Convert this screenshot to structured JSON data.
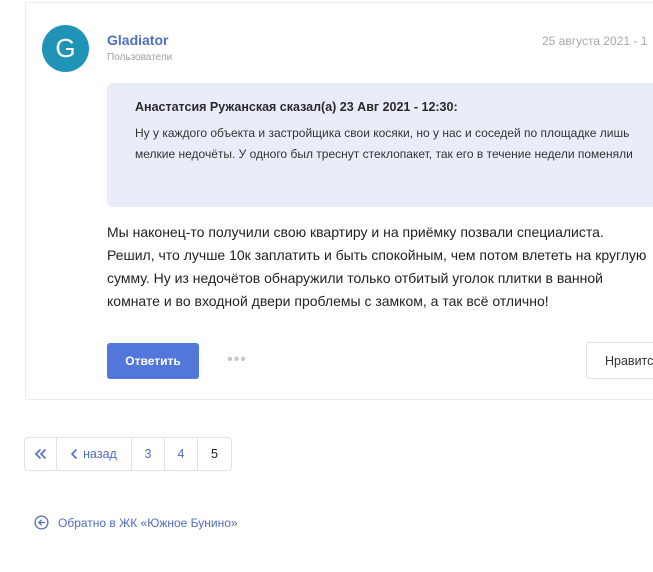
{
  "post": {
    "avatar_letter": "G",
    "author": "Gladiator",
    "group": "Пользователи",
    "date": "25 августа 2021 - 1",
    "quote": {
      "header": "Анастатсия Ружанская сказал(а) 23 Авг 2021 - 12:30:",
      "text": "Ну у каждого объекта и застройщика свои косяки, но у нас и соседей по площадке лишь мелкие недочёты. У одного был треснут стеклопакет, так его в течение недели поменяли"
    },
    "message": "Мы наконец-то получили свою квартиру и на приёмку позвали специалиста. Решил, что лучше 10к заплатить и быть спокойным, чем потом влететь на круглую сумму. Ну из недочётов обнаружили только отбитый уголок плитки в ванной комнате и во входной двери проблемы с замком, а так всё отлично!",
    "actions": {
      "reply_label": "Ответить",
      "more_label": "•••",
      "like_label": "Нравится"
    }
  },
  "pagination": {
    "first_label": "«",
    "prev_label": "назад",
    "pages": [
      "3",
      "4",
      "5"
    ],
    "current": "5"
  },
  "back_link": "Обратно в ЖК «Южное Бунино»",
  "colors": {
    "accent": "#5276da",
    "link": "#4f6ec2",
    "avatar": "#1f94b6",
    "quote_bg": "#e9edfa"
  }
}
